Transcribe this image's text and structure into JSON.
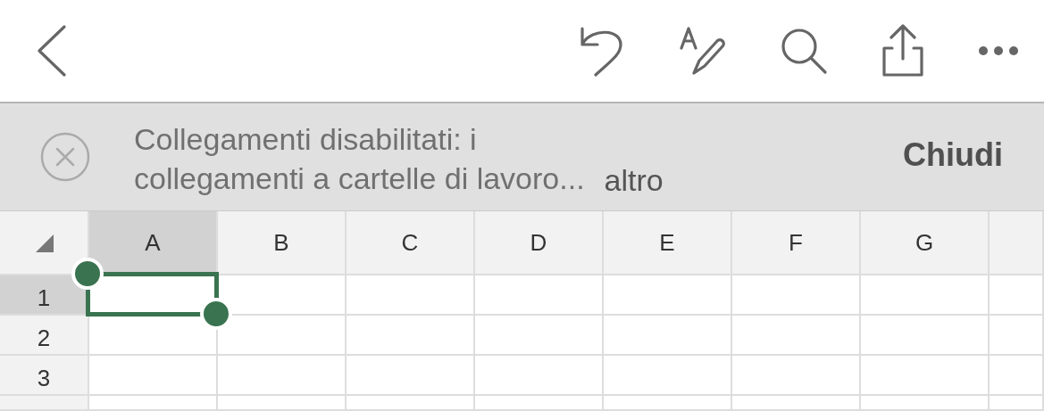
{
  "banner": {
    "message": "Collegamenti disabilitati: i\ncollegamenti a cartelle di lavoro...",
    "more_link": "altro",
    "close_button": "Chiudi"
  },
  "sheet": {
    "columns": [
      {
        "label": "A",
        "selected": true
      },
      {
        "label": "B",
        "selected": false
      },
      {
        "label": "C",
        "selected": false
      },
      {
        "label": "D",
        "selected": false
      },
      {
        "label": "E",
        "selected": false
      },
      {
        "label": "F",
        "selected": false
      },
      {
        "label": "G",
        "selected": false
      }
    ],
    "rows": [
      {
        "label": "1",
        "selected": true
      },
      {
        "label": "2",
        "selected": false
      },
      {
        "label": "3",
        "selected": false
      }
    ]
  }
}
